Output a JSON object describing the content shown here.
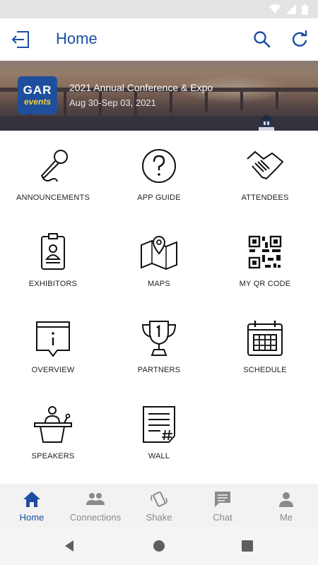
{
  "app_bar": {
    "title": "Home",
    "back_icon": "exit-icon",
    "search_icon": "search-icon",
    "refresh_icon": "refresh-icon",
    "accent_color": "#1b4ea3"
  },
  "banner": {
    "logo_text_top": "GAR",
    "logo_text_bottom": "events",
    "event_title": "2021 Annual Conference & Expo",
    "event_dates": "Aug 30-Sep 03, 2021"
  },
  "tiles": [
    {
      "label": "ANNOUNCEMENTS",
      "icon": "microphone-icon"
    },
    {
      "label": "APP GUIDE",
      "icon": "question-icon"
    },
    {
      "label": "ATTENDEES",
      "icon": "handshake-icon"
    },
    {
      "label": "EXHIBITORS",
      "icon": "badge-icon"
    },
    {
      "label": "MAPS",
      "icon": "map-icon"
    },
    {
      "label": "MY QR CODE",
      "icon": "qr-code-icon"
    },
    {
      "label": "OVERVIEW",
      "icon": "info-icon"
    },
    {
      "label": "PARTNERS",
      "icon": "trophy-icon"
    },
    {
      "label": "SCHEDULE",
      "icon": "calendar-icon"
    },
    {
      "label": "SPEAKERS",
      "icon": "podium-icon"
    },
    {
      "label": "WALL",
      "icon": "wall-icon"
    }
  ],
  "bottom_nav": [
    {
      "label": "Home",
      "icon": "home-icon",
      "active": true
    },
    {
      "label": "Connections",
      "icon": "people-icon",
      "active": false
    },
    {
      "label": "Shake",
      "icon": "shake-icon",
      "active": false
    },
    {
      "label": "Chat",
      "icon": "chat-icon",
      "active": false
    },
    {
      "label": "Me",
      "icon": "person-icon",
      "active": false
    }
  ],
  "colors": {
    "nav_active": "#1b4ea3",
    "nav_inactive": "#8a8a8a"
  }
}
